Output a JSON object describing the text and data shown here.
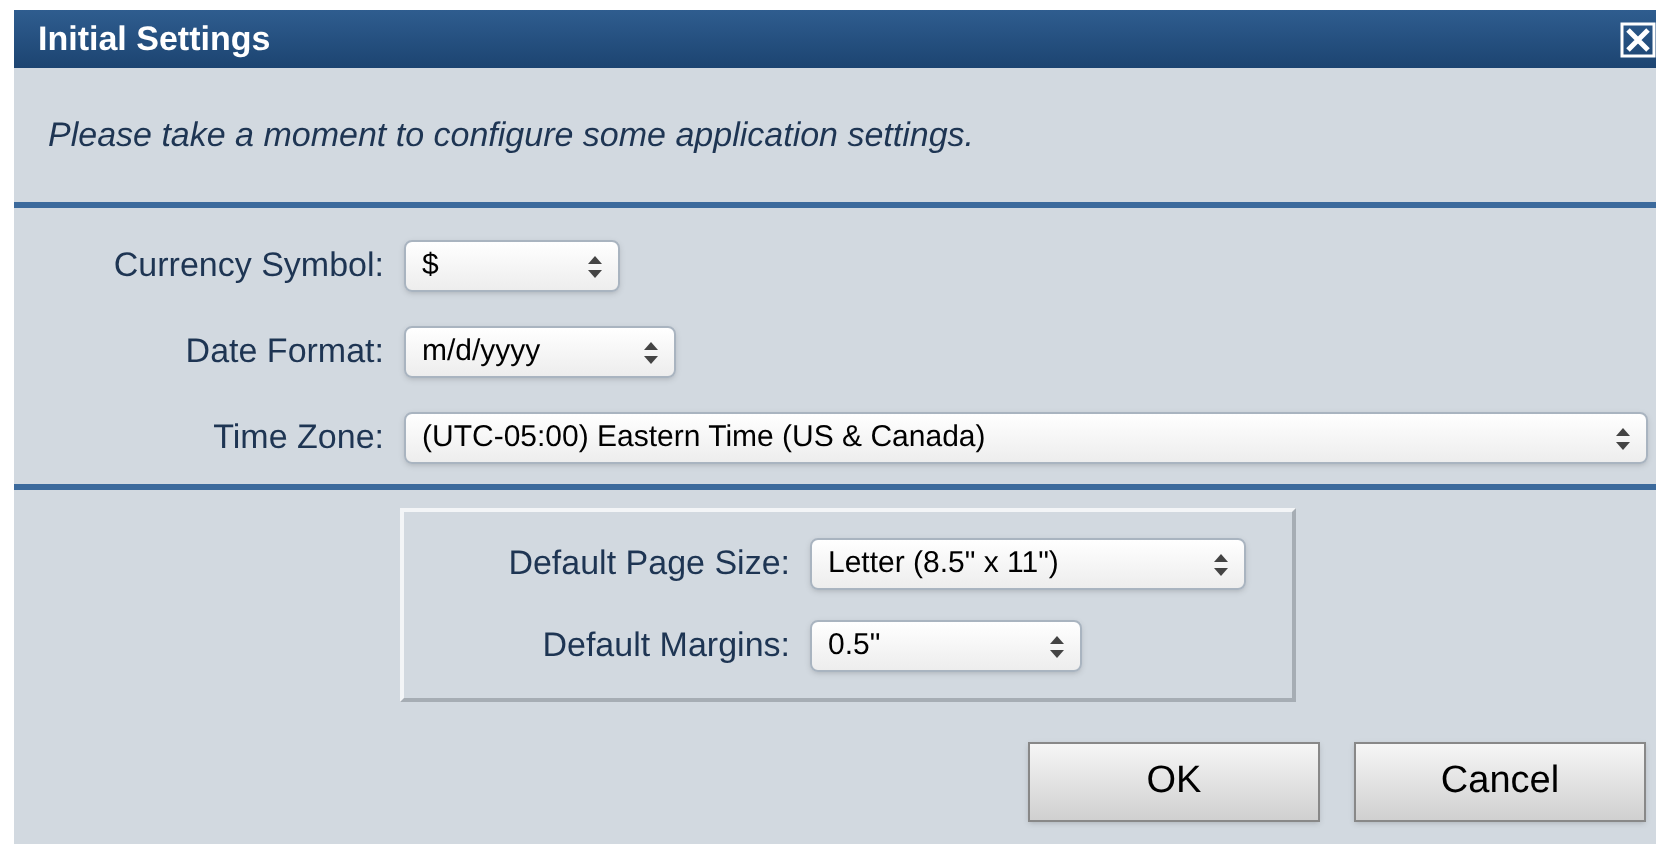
{
  "window": {
    "title": "Initial Settings"
  },
  "intro": "Please take a moment to configure some application settings.",
  "fields": [
    {
      "label": "Currency Symbol:",
      "value": "$"
    },
    {
      "label": "Date Format:",
      "value": "m/d/yyyy"
    },
    {
      "label": "Time Zone:",
      "value": "(UTC-05:00) Eastern Time (US & Canada)"
    }
  ],
  "page_fields": [
    {
      "label": "Default Page Size:",
      "value": "Letter (8.5\" x 11\")"
    },
    {
      "label": "Default Margins:",
      "value": "0.5\""
    }
  ],
  "buttons": [
    "OK",
    "Cancel"
  ]
}
